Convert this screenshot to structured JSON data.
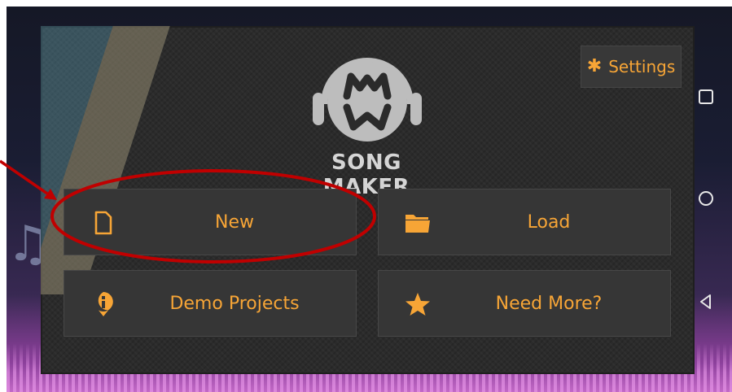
{
  "app": {
    "title": "SONG MAKER",
    "logo_icon": "mw-headphones-logo"
  },
  "settings": {
    "label": "Settings",
    "icon": "gear-icon"
  },
  "menu": {
    "new": {
      "label": "New",
      "icon": "new-file-icon"
    },
    "load": {
      "label": "Load",
      "icon": "folder-icon"
    },
    "demo": {
      "label": "Demo Projects",
      "icon": "info-bubble-icon"
    },
    "more": {
      "label": "Need More?",
      "icon": "star-icon"
    }
  },
  "system_nav": {
    "items": [
      "recent-apps",
      "home",
      "back"
    ]
  },
  "colors": {
    "accent": "#f7a536",
    "panel": "#2b2b2b",
    "button": "#363636",
    "title": "#d5d5d5",
    "annotation": "#c00000"
  }
}
